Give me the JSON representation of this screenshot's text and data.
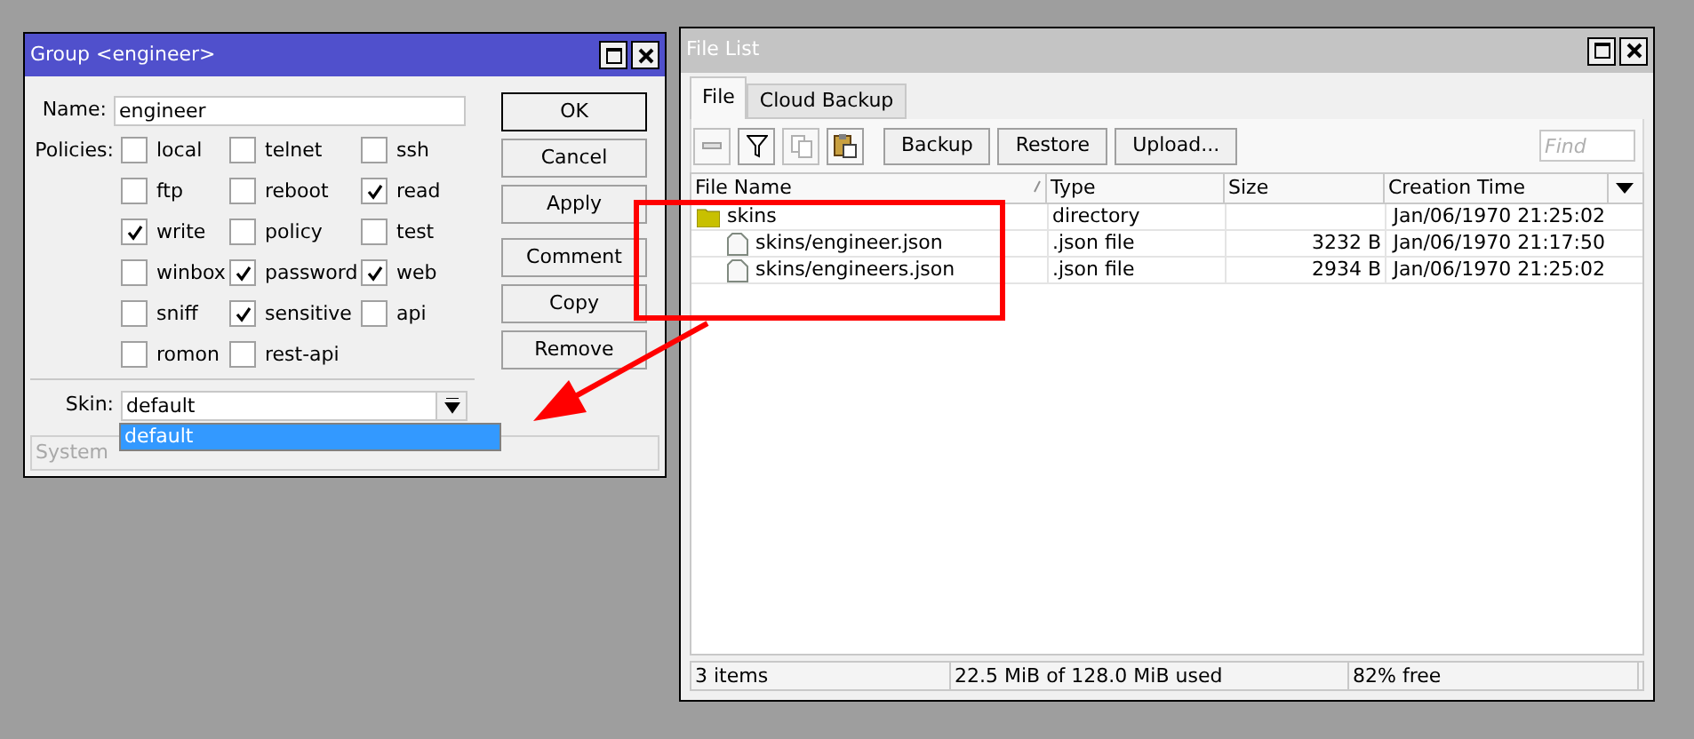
{
  "group_window": {
    "title": "Group <engineer>",
    "name_label": "Name:",
    "name_value": "engineer",
    "policies_label": "Policies:",
    "policies": [
      {
        "label": "local",
        "checked": false
      },
      {
        "label": "telnet",
        "checked": false
      },
      {
        "label": "ssh",
        "checked": false
      },
      {
        "label": "ftp",
        "checked": false
      },
      {
        "label": "reboot",
        "checked": false
      },
      {
        "label": "read",
        "checked": true
      },
      {
        "label": "write",
        "checked": true
      },
      {
        "label": "policy",
        "checked": false
      },
      {
        "label": "test",
        "checked": false
      },
      {
        "label": "winbox",
        "checked": false
      },
      {
        "label": "password",
        "checked": true
      },
      {
        "label": "web",
        "checked": true
      },
      {
        "label": "sniff",
        "checked": false
      },
      {
        "label": "sensitive",
        "checked": true
      },
      {
        "label": "api",
        "checked": false
      },
      {
        "label": "romon",
        "checked": false
      },
      {
        "label": "rest-api",
        "checked": false
      }
    ],
    "skin_label": "Skin:",
    "skin_value": "default",
    "skin_options": [
      {
        "label": "default",
        "selected": true
      }
    ],
    "status": "System",
    "buttons": [
      {
        "label": "OK",
        "default": true
      },
      {
        "label": "Cancel",
        "default": false
      },
      {
        "label": "Apply",
        "default": false
      },
      {
        "label": "Comment",
        "default": false
      },
      {
        "label": "Copy",
        "default": false
      },
      {
        "label": "Remove",
        "default": false
      }
    ]
  },
  "file_window": {
    "title": "File List",
    "tabs": [
      {
        "label": "File",
        "selected": true
      },
      {
        "label": "Cloud Backup",
        "selected": false
      }
    ],
    "toolbar_buttons": [
      "Backup",
      "Restore",
      "Upload..."
    ],
    "find": {
      "placeholder": "Find"
    },
    "columns": [
      {
        "label": "File Name",
        "sorted": true
      },
      {
        "label": "Type",
        "sorted": false
      },
      {
        "label": "Size",
        "sorted": false
      },
      {
        "label": "Creation Time",
        "sorted": false
      }
    ],
    "rows": [
      {
        "kind": "folder",
        "name": "skins",
        "type": "directory",
        "size": "",
        "time": "Jan/06/1970 21:25:02",
        "children": [
          {
            "kind": "file",
            "name": "skins/engineer.json",
            "type": ".json file",
            "size": "3232 B",
            "time": "Jan/06/1970 21:17:50"
          },
          {
            "kind": "file",
            "name": "skins/engineers.json",
            "type": ".json file",
            "size": "2934 B",
            "time": "Jan/06/1970 21:25:02"
          }
        ]
      }
    ],
    "status_bar": [
      "3 items",
      "22.5 MiB of 128.0 MiB used",
      "82% free"
    ]
  }
}
